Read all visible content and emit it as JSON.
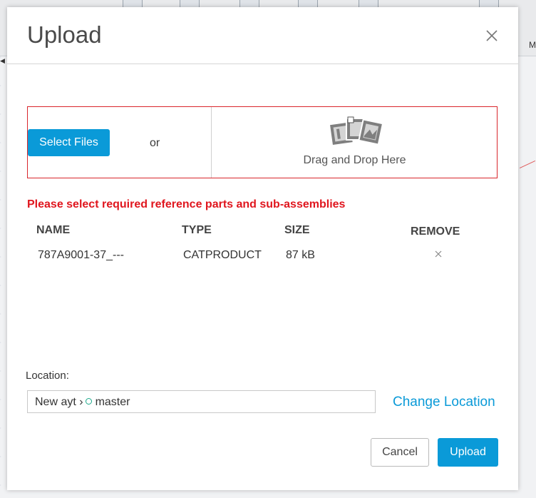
{
  "background": {
    "side_letter": "M"
  },
  "dialog": {
    "title": "Upload",
    "select_files_label": "Select Files",
    "or_label": "or",
    "drag_drop_label": "Drag and Drop Here",
    "warning": "Please select required reference parts and sub-assemblies",
    "table": {
      "headers": {
        "name": "NAME",
        "type": "TYPE",
        "size": "SIZE",
        "remove": "REMOVE"
      },
      "rows": [
        {
          "name": "787A9001-37_---",
          "type": "CATPRODUCT",
          "size": "87 kB"
        }
      ]
    },
    "location": {
      "label": "Location:",
      "project": "New ayt",
      "separator": "›",
      "branch": "master",
      "change_label": "Change Location"
    },
    "buttons": {
      "cancel": "Cancel",
      "upload": "Upload"
    }
  },
  "colors": {
    "accent": "#0a9ad8",
    "warning": "#e0161e",
    "drop_border": "#d9262c",
    "branch": "#1ba88a"
  },
  "icons": [
    "close-icon",
    "drag-drop-images-icon",
    "remove-x-icon",
    "branch-icon"
  ]
}
